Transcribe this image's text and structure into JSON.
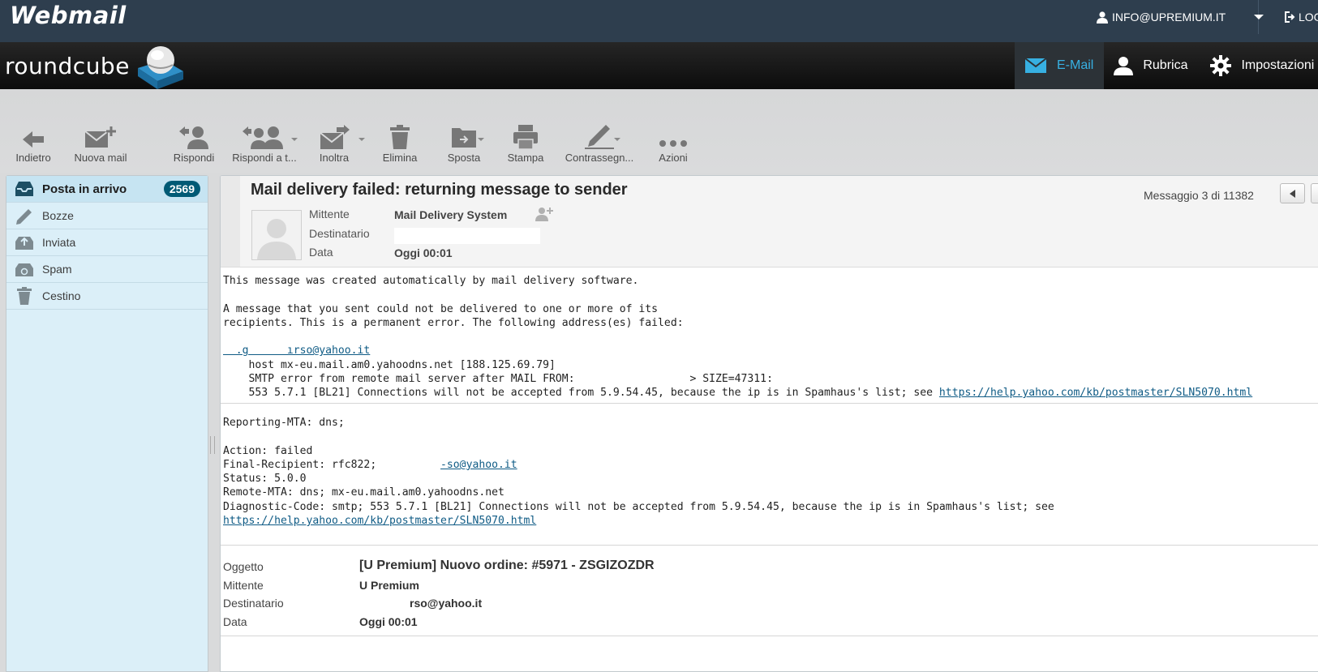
{
  "topbar": {
    "brand": "Webmail",
    "user": "INFO@UPREMIUM.IT",
    "logout": "LOGOUT"
  },
  "header": {
    "logo": "roundcube",
    "nav": [
      {
        "label": "E-Mail",
        "icon": "mail-icon",
        "active": true
      },
      {
        "label": "Rubrica",
        "icon": "person-icon",
        "active": false
      },
      {
        "label": "Impostazioni",
        "icon": "gear-icon",
        "active": false
      }
    ]
  },
  "toolbar": {
    "back": "Indietro",
    "compose": "Nuova mail",
    "reply": "Rispondi",
    "reply_all": "Rispondi a t...",
    "forward": "Inoltra",
    "delete": "Elimina",
    "move": "Sposta",
    "print": "Stampa",
    "mark": "Contrassegn...",
    "more": "Azioni"
  },
  "folders": [
    {
      "label": "Posta in arrivo",
      "icon": "inbox-icon",
      "count": "2569",
      "selected": true
    },
    {
      "label": "Bozze",
      "icon": "pencil-icon"
    },
    {
      "label": "Inviata",
      "icon": "sent-icon"
    },
    {
      "label": "Spam",
      "icon": "spam-icon"
    },
    {
      "label": "Cestino",
      "icon": "trash-icon"
    }
  ],
  "message": {
    "subject": "Mail delivery failed: returning message to sender",
    "counter": "Messaggio 3 di 11382",
    "labels": {
      "from": "Mittente",
      "to": "Destinatario",
      "date": "Data"
    },
    "from": "Mail Delivery System",
    "date": "Oggi 00:01",
    "body": {
      "l1": "This message was created automatically by mail delivery software.",
      "l3": "A message that you sent could not be delivered to one or more of its",
      "l4": "recipients. This is a permanent error. The following address(es) failed:",
      "addr1": "  .g      ırso@yahoo.it",
      "l7": "    host mx-eu.mail.am0.yahoodns.net [188.125.69.79]",
      "l8": "    SMTP error from remote mail server after MAIL FROM:                  > SIZE=47311:",
      "l9": "    553 5.7.1 [BL21] Connections will not be accepted from 5.9.54.45, because the ip is in Spamhaus's list; see ",
      "link1": "https://help.yahoo.com/kb/postmaster/SLN5070.html",
      "r1": "Reporting-MTA: dns;",
      "r3": "Action: failed",
      "r4a": "Final-Recipient: rfc822",
      "r4b": ";          ",
      "r4link": "-so@yahoo.it",
      "r5": "Status: 5.0.0",
      "r6": "Remote-MTA: dns; mx-eu.mail.am0.yahoodns.net",
      "r7": "Diagnostic-Code: smtp; 553 5.7.1 [BL21] Connections will not be accepted from 5.9.54.45, because the ip is in Spamhaus's list; see",
      "link2": "https://help.yahoo.com/kb/postmaster/SLN5070.html"
    },
    "attached": {
      "labels": {
        "subject": "Oggetto",
        "from": "Mittente",
        "to": "Destinatario",
        "date": "Data"
      },
      "subject": "[U Premium] Nuovo ordine: #5971 - ZSGIZOZDR",
      "from": "U Premium",
      "to": "rso@yahoo.it",
      "date": "Oggi 00:01"
    }
  },
  "colors": {
    "accent": "#37b0e2",
    "badge": "#005a75",
    "sidebar": "#dbeff8",
    "topbar": "#2e3e4e"
  }
}
